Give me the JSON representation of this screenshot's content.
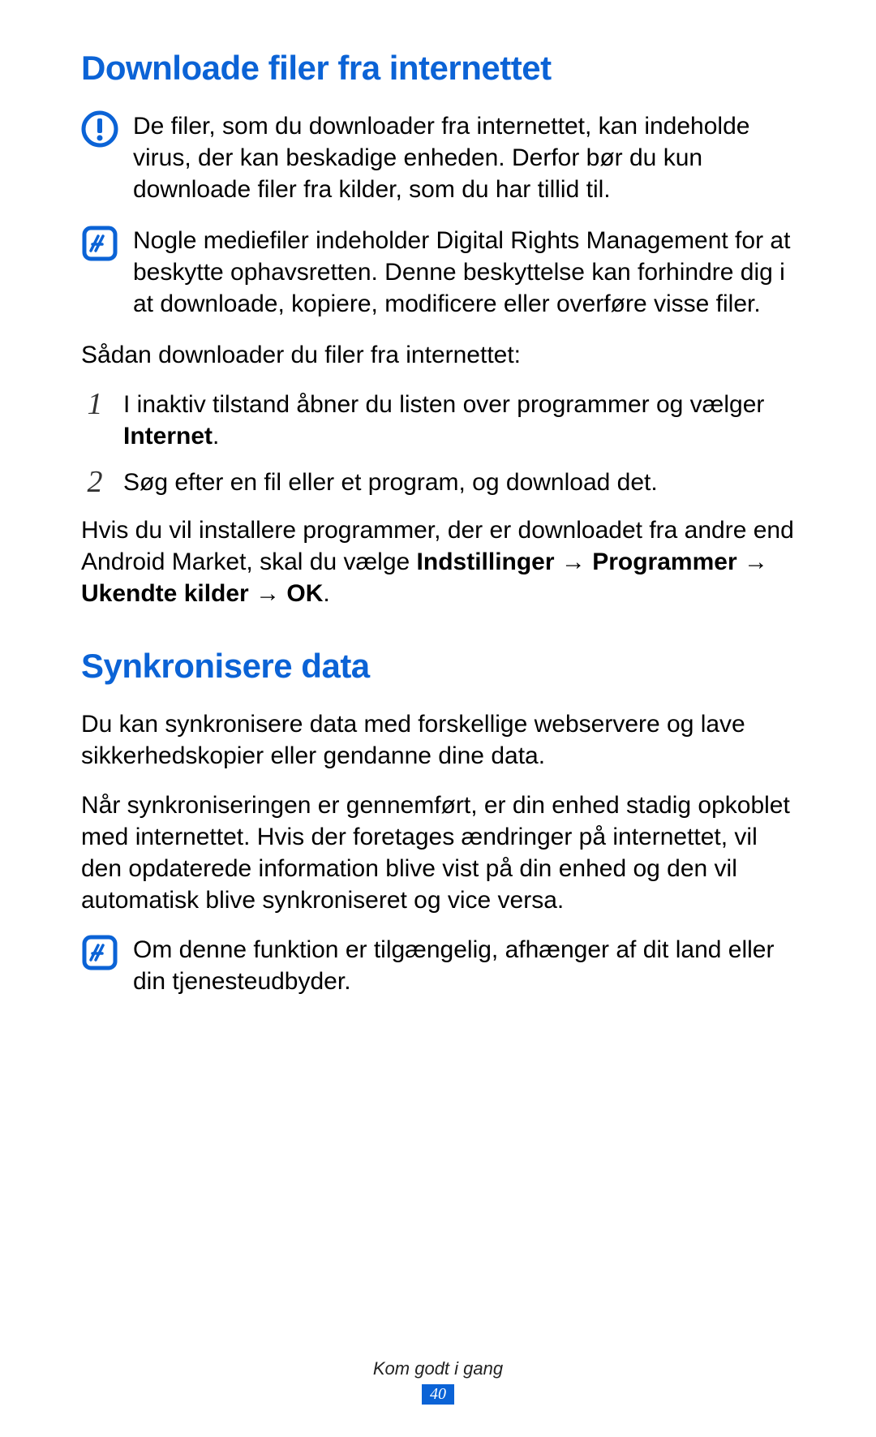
{
  "section1": {
    "heading": "Downloade filer fra internettet",
    "warning": "De filer, som du downloader fra internettet, kan indeholde virus, der kan beskadige enheden. Derfor bør du kun downloade filer fra kilder, som du har tillid til.",
    "note1": "Nogle mediefiler indeholder Digital Rights Management for at beskytte ophavsretten. Denne beskyttelse kan forhindre dig i at downloade, kopiere, modificere eller overføre visse filer.",
    "intro": "Sådan downloader du filer fra internettet:",
    "step1_num": "1",
    "step1_text": "I inaktiv tilstand åbner du listen over programmer og vælger ",
    "step1_bold": "Internet",
    "step1_end": ".",
    "step2_num": "2",
    "step2_text": "Søg efter en fil eller et program, og download det.",
    "post_text_a": "Hvis du vil installere programmer, der er downloadet fra andre end Android Market, skal du vælge ",
    "post_bold1": "Indstillinger",
    "arrow": " → ",
    "post_bold2": "Programmer",
    "post_bold3": "Ukendte kilder",
    "post_bold4": "OK",
    "post_end": "."
  },
  "section2": {
    "heading": "Synkronisere data",
    "para1": "Du kan synkronisere data med forskellige webservere og lave sikkerhedskopier eller gendanne dine data.",
    "para2": "Når synkroniseringen er gennemført, er din enhed stadig opkoblet med internettet. Hvis der foretages ændringer på internettet, vil den opdaterede information blive vist på din enhed og den vil automatisk blive synkroniseret og vice versa.",
    "note": "Om denne funktion er tilgængelig, afhænger af dit land eller din tjenesteudbyder."
  },
  "footer": {
    "label": "Kom godt i gang",
    "page": "40"
  }
}
